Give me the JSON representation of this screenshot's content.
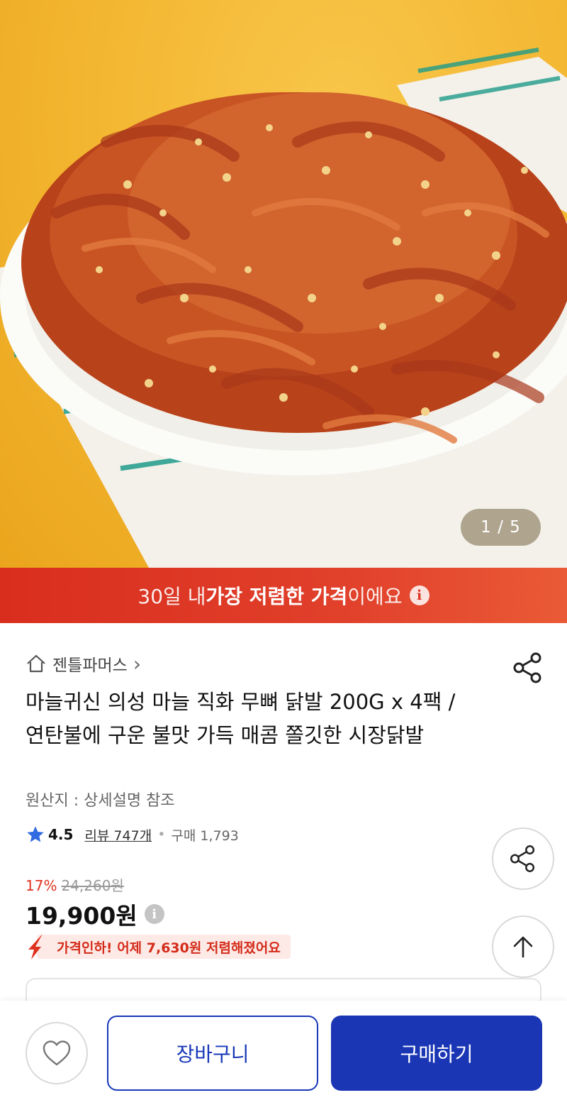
{
  "hero": {
    "image_alt": "product-photo",
    "pager": "1 / 5"
  },
  "banner": {
    "prefix": "30일 내 ",
    "highlight": "가장 저렴한 가격",
    "suffix": "이에요",
    "info_symbol": "i"
  },
  "store": {
    "name": "젠틀파머스",
    "chevron": "›"
  },
  "product": {
    "title": "마늘귀신 의성 마늘 직화 무뼈 닭발 200G x 4팩 / 연탄불에 구운 불맛 가득 매콤 쫄깃한 시장닭발",
    "origin": "원산지 : 상세설명 참조"
  },
  "rating": {
    "score": "4.5",
    "reviews": "리뷰 747개",
    "separator": "•",
    "purchases": "구매 1,793"
  },
  "price": {
    "discount_rate": "17%",
    "original": "24,260원",
    "current": "19,900원",
    "info_symbol": "i",
    "drop_message": "가격인하! 어제 7,630원 저렴해졌어요"
  },
  "bottom": {
    "cart_label": "장바구니",
    "buy_label": "구매하기"
  },
  "colors": {
    "accent_blue": "#1a36b5",
    "banner_red": "#d92e1e",
    "discount_red": "#e0331f",
    "star_blue": "#2f6ae0"
  },
  "icons": [
    "home-icon",
    "share-icon",
    "star-icon",
    "info-icon",
    "arrow-up-icon",
    "heart-icon",
    "price-drop-arrow-icon"
  ]
}
